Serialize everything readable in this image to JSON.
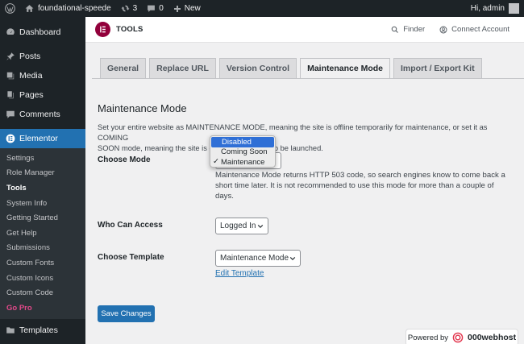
{
  "adminbar": {
    "site_name": "foundational-speede",
    "updates_count": "3",
    "comments_count": "0",
    "new_label": "New",
    "greeting": "Hi, admin"
  },
  "sidebar": {
    "items": [
      {
        "label": "Dashboard",
        "icon": "dashboard-icon"
      },
      {
        "label": "Posts",
        "icon": "pin-icon"
      },
      {
        "label": "Media",
        "icon": "media-icon"
      },
      {
        "label": "Pages",
        "icon": "pages-icon"
      },
      {
        "label": "Comments",
        "icon": "comment-icon"
      },
      {
        "label": "Elementor",
        "icon": "elementor-icon"
      }
    ],
    "submenu": [
      "Settings",
      "Role Manager",
      "Tools",
      "System Info",
      "Getting Started",
      "Get Help",
      "Submissions",
      "Custom Fonts",
      "Custom Icons",
      "Custom Code",
      "Go Pro"
    ],
    "bottom_item": {
      "label": "Templates",
      "icon": "templates-icon"
    }
  },
  "header": {
    "title": "TOOLS",
    "finder_label": "Finder",
    "connect_label": "Connect Account"
  },
  "tabs": [
    "General",
    "Replace URL",
    "Version Control",
    "Maintenance Mode",
    "Import / Export Kit"
  ],
  "active_tab": "Maintenance Mode",
  "content": {
    "section_title": "Maintenance Mode",
    "description_line1": "Set your entire website as MAINTENANCE MODE, meaning the site is offline temporarily for maintenance, or set it as COMING",
    "description_line2_start": "SOON mode, meaning the site is of",
    "description_line2_end": "to be launched.",
    "choose_mode_label": "Choose Mode",
    "mode_help_text": "Maintenance Mode returns HTTP 503 code, so search engines know to come back a short time later. It is not recommended to use this mode for more than a couple of days.",
    "who_can_access_label": "Who Can Access",
    "who_can_access_value": "Logged In",
    "choose_template_label": "Choose Template",
    "template_value": "Maintenance Mode",
    "edit_template_link": "Edit Template",
    "save_button": "Save Changes"
  },
  "mode_dropdown": {
    "options": [
      "Disabled",
      "Coming Soon",
      "Maintenance"
    ],
    "highlighted": "Disabled",
    "checked": "Maintenance",
    "check_mark": "✓"
  },
  "powered_by": {
    "prefix": "Powered by",
    "brand": "000webhost"
  },
  "colors": {
    "admin_bar": "#1d2327",
    "accent_blue": "#2271b1",
    "elementor_brand": "#92003b",
    "go_pro": "#e2498a",
    "dropdown_highlight": "#2f6fd6"
  }
}
